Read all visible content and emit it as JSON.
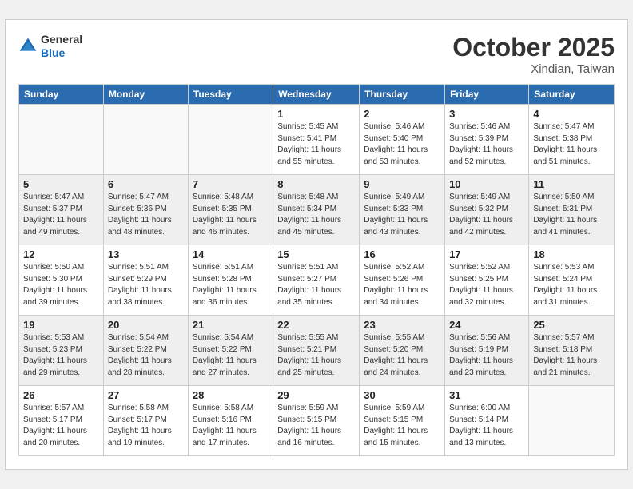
{
  "header": {
    "logo": {
      "line1": "General",
      "line2": "Blue"
    },
    "title": "October 2025",
    "location": "Xindian, Taiwan"
  },
  "days_of_week": [
    "Sunday",
    "Monday",
    "Tuesday",
    "Wednesday",
    "Thursday",
    "Friday",
    "Saturday"
  ],
  "weeks": [
    [
      {
        "day": "",
        "info": ""
      },
      {
        "day": "",
        "info": ""
      },
      {
        "day": "",
        "info": ""
      },
      {
        "day": "1",
        "info": "Sunrise: 5:45 AM\nSunset: 5:41 PM\nDaylight: 11 hours\nand 55 minutes."
      },
      {
        "day": "2",
        "info": "Sunrise: 5:46 AM\nSunset: 5:40 PM\nDaylight: 11 hours\nand 53 minutes."
      },
      {
        "day": "3",
        "info": "Sunrise: 5:46 AM\nSunset: 5:39 PM\nDaylight: 11 hours\nand 52 minutes."
      },
      {
        "day": "4",
        "info": "Sunrise: 5:47 AM\nSunset: 5:38 PM\nDaylight: 11 hours\nand 51 minutes."
      }
    ],
    [
      {
        "day": "5",
        "info": "Sunrise: 5:47 AM\nSunset: 5:37 PM\nDaylight: 11 hours\nand 49 minutes."
      },
      {
        "day": "6",
        "info": "Sunrise: 5:47 AM\nSunset: 5:36 PM\nDaylight: 11 hours\nand 48 minutes."
      },
      {
        "day": "7",
        "info": "Sunrise: 5:48 AM\nSunset: 5:35 PM\nDaylight: 11 hours\nand 46 minutes."
      },
      {
        "day": "8",
        "info": "Sunrise: 5:48 AM\nSunset: 5:34 PM\nDaylight: 11 hours\nand 45 minutes."
      },
      {
        "day": "9",
        "info": "Sunrise: 5:49 AM\nSunset: 5:33 PM\nDaylight: 11 hours\nand 43 minutes."
      },
      {
        "day": "10",
        "info": "Sunrise: 5:49 AM\nSunset: 5:32 PM\nDaylight: 11 hours\nand 42 minutes."
      },
      {
        "day": "11",
        "info": "Sunrise: 5:50 AM\nSunset: 5:31 PM\nDaylight: 11 hours\nand 41 minutes."
      }
    ],
    [
      {
        "day": "12",
        "info": "Sunrise: 5:50 AM\nSunset: 5:30 PM\nDaylight: 11 hours\nand 39 minutes."
      },
      {
        "day": "13",
        "info": "Sunrise: 5:51 AM\nSunset: 5:29 PM\nDaylight: 11 hours\nand 38 minutes."
      },
      {
        "day": "14",
        "info": "Sunrise: 5:51 AM\nSunset: 5:28 PM\nDaylight: 11 hours\nand 36 minutes."
      },
      {
        "day": "15",
        "info": "Sunrise: 5:51 AM\nSunset: 5:27 PM\nDaylight: 11 hours\nand 35 minutes."
      },
      {
        "day": "16",
        "info": "Sunrise: 5:52 AM\nSunset: 5:26 PM\nDaylight: 11 hours\nand 34 minutes."
      },
      {
        "day": "17",
        "info": "Sunrise: 5:52 AM\nSunset: 5:25 PM\nDaylight: 11 hours\nand 32 minutes."
      },
      {
        "day": "18",
        "info": "Sunrise: 5:53 AM\nSunset: 5:24 PM\nDaylight: 11 hours\nand 31 minutes."
      }
    ],
    [
      {
        "day": "19",
        "info": "Sunrise: 5:53 AM\nSunset: 5:23 PM\nDaylight: 11 hours\nand 29 minutes."
      },
      {
        "day": "20",
        "info": "Sunrise: 5:54 AM\nSunset: 5:22 PM\nDaylight: 11 hours\nand 28 minutes."
      },
      {
        "day": "21",
        "info": "Sunrise: 5:54 AM\nSunset: 5:22 PM\nDaylight: 11 hours\nand 27 minutes."
      },
      {
        "day": "22",
        "info": "Sunrise: 5:55 AM\nSunset: 5:21 PM\nDaylight: 11 hours\nand 25 minutes."
      },
      {
        "day": "23",
        "info": "Sunrise: 5:55 AM\nSunset: 5:20 PM\nDaylight: 11 hours\nand 24 minutes."
      },
      {
        "day": "24",
        "info": "Sunrise: 5:56 AM\nSunset: 5:19 PM\nDaylight: 11 hours\nand 23 minutes."
      },
      {
        "day": "25",
        "info": "Sunrise: 5:57 AM\nSunset: 5:18 PM\nDaylight: 11 hours\nand 21 minutes."
      }
    ],
    [
      {
        "day": "26",
        "info": "Sunrise: 5:57 AM\nSunset: 5:17 PM\nDaylight: 11 hours\nand 20 minutes."
      },
      {
        "day": "27",
        "info": "Sunrise: 5:58 AM\nSunset: 5:17 PM\nDaylight: 11 hours\nand 19 minutes."
      },
      {
        "day": "28",
        "info": "Sunrise: 5:58 AM\nSunset: 5:16 PM\nDaylight: 11 hours\nand 17 minutes."
      },
      {
        "day": "29",
        "info": "Sunrise: 5:59 AM\nSunset: 5:15 PM\nDaylight: 11 hours\nand 16 minutes."
      },
      {
        "day": "30",
        "info": "Sunrise: 5:59 AM\nSunset: 5:15 PM\nDaylight: 11 hours\nand 15 minutes."
      },
      {
        "day": "31",
        "info": "Sunrise: 6:00 AM\nSunset: 5:14 PM\nDaylight: 11 hours\nand 13 minutes."
      },
      {
        "day": "",
        "info": ""
      }
    ]
  ]
}
